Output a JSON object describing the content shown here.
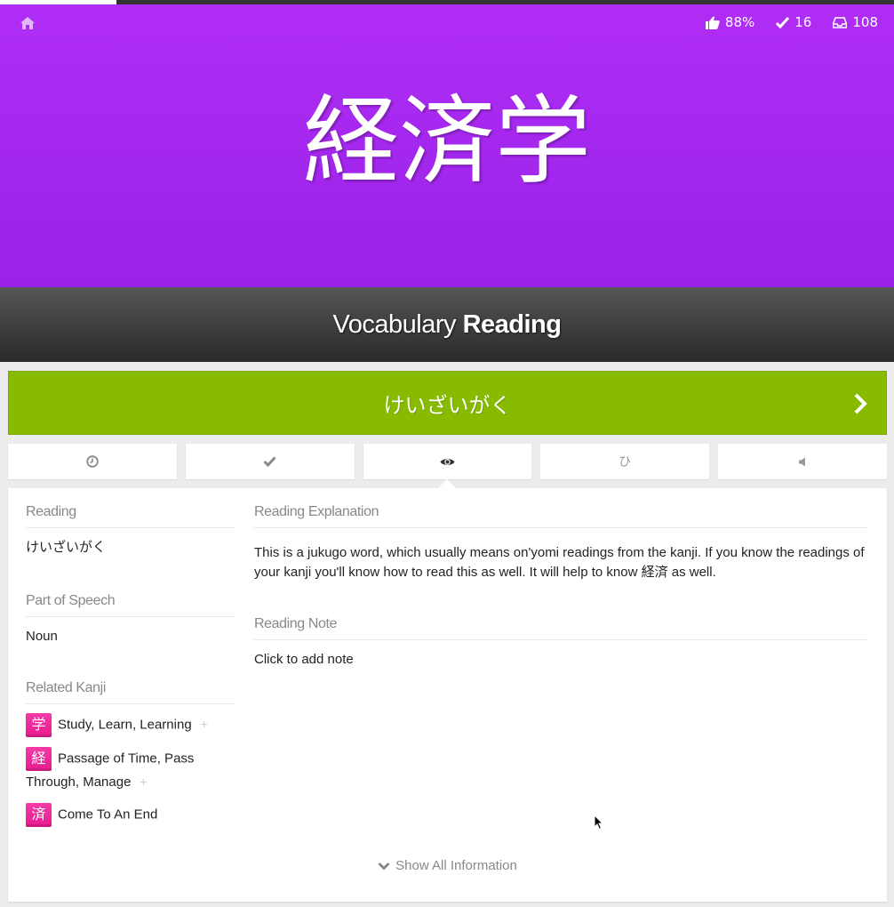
{
  "progress": {
    "fraction": 0.13
  },
  "header": {
    "stats": {
      "percent_correct": "88%",
      "completed": "16",
      "remaining": "108"
    },
    "subject": "経済学",
    "background_color": "#a729f0"
  },
  "quiz": {
    "item_type": "Vocabulary",
    "question_type": "Reading"
  },
  "answer": {
    "value": "けいざいがく",
    "status_color": "#88bb00"
  },
  "tabs": [
    {
      "icon": "clock-icon",
      "glyph": "◷"
    },
    {
      "icon": "check-icon",
      "glyph": "✔"
    },
    {
      "icon": "eye-icon",
      "glyph": "👁"
    },
    {
      "icon": "hiragana-icon",
      "glyph": "ひ"
    },
    {
      "icon": "audio-icon",
      "glyph": "◀"
    }
  ],
  "info": {
    "reading": {
      "title": "Reading",
      "value": "けいざいがく"
    },
    "part_of_speech": {
      "title": "Part of Speech",
      "value": "Noun"
    },
    "related_kanji": {
      "title": "Related Kanji",
      "items": [
        {
          "kanji": "学",
          "meaning": "Study, Learn, Learning"
        },
        {
          "kanji": "経",
          "meaning": "Passage of Time, Pass Through, Manage"
        },
        {
          "kanji": "済",
          "meaning": "Come To An End"
        }
      ],
      "badge_color": "#f000a1"
    },
    "reading_explanation": {
      "title": "Reading Explanation",
      "text": "This is a jukugo word, which usually means on'yomi readings from the kanji. If you know the readings of your kanji you'll know how to read this as well. It will help to know 経済 as well."
    },
    "reading_note": {
      "title": "Reading Note",
      "text": "Click to add note"
    },
    "show_all": "Show All Information"
  }
}
